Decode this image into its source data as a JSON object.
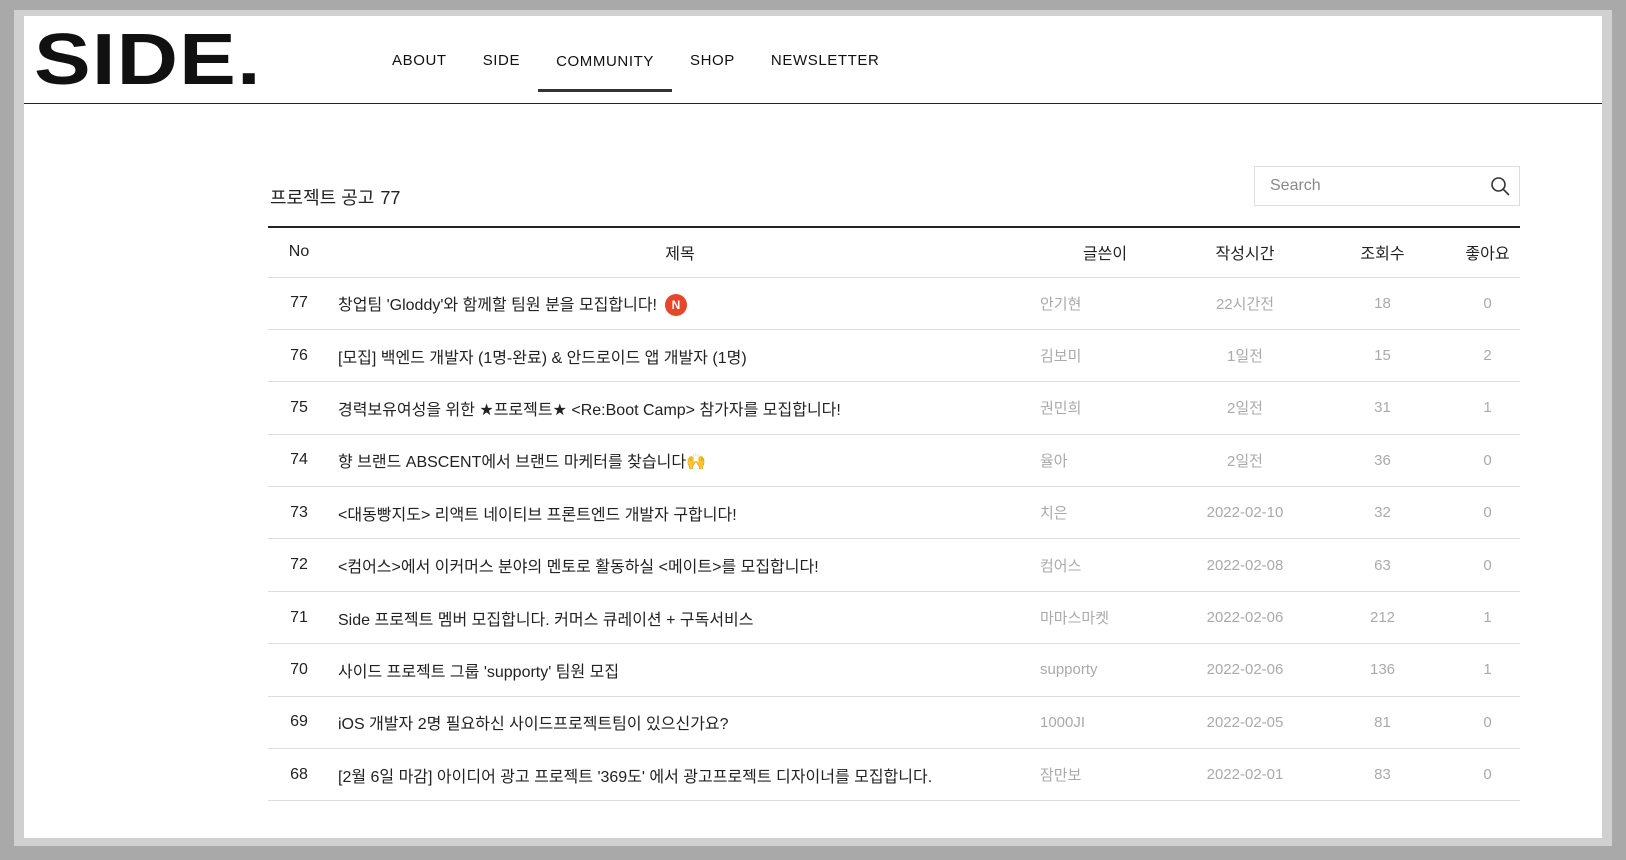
{
  "header": {
    "logo": "SIDE.",
    "nav": [
      "ABOUT",
      "SIDE",
      "COMMUNITY",
      "SHOP",
      "NEWSLETTER"
    ],
    "active_nav": "COMMUNITY"
  },
  "board": {
    "title": "프로젝트 공고",
    "count": "77",
    "search_placeholder": "Search",
    "columns": {
      "no": "No",
      "title": "제목",
      "writer": "글쓴이",
      "date": "작성시간",
      "views": "조회수",
      "likes": "좋아요"
    },
    "new_badge": "N",
    "rows": [
      {
        "no": "77",
        "title": "창업팀 'Gloddy'와 함께할 팀원 분을 모집합니다!",
        "is_new": true,
        "writer": "안기현",
        "date": "22시간전",
        "views": "18",
        "likes": "0"
      },
      {
        "no": "76",
        "title": "[모집] 백엔드 개발자 (1명-완료) & 안드로이드 앱 개발자 (1명)",
        "is_new": false,
        "writer": "김보미",
        "date": "1일전",
        "views": "15",
        "likes": "2"
      },
      {
        "no": "75",
        "title": "경력보유여성을 위한 ★프로젝트★ <Re:Boot Camp> 참가자를 모집합니다!",
        "is_new": false,
        "writer": "권민희",
        "date": "2일전",
        "views": "31",
        "likes": "1"
      },
      {
        "no": "74",
        "title": "향 브랜드 ABSCENT에서 브랜드 마케터를 찾습니다🙌",
        "is_new": false,
        "writer": "율아",
        "date": "2일전",
        "views": "36",
        "likes": "0"
      },
      {
        "no": "73",
        "title": "<대동빵지도> 리액트 네이티브 프론트엔드 개발자 구합니다!",
        "is_new": false,
        "writer": "치은",
        "date": "2022-02-10",
        "views": "32",
        "likes": "0"
      },
      {
        "no": "72",
        "title": "<컴어스>에서 이커머스 분야의 멘토로 활동하실 <메이트>를 모집합니다!",
        "is_new": false,
        "writer": "컴어스",
        "date": "2022-02-08",
        "views": "63",
        "likes": "0"
      },
      {
        "no": "71",
        "title": "Side 프로젝트 멤버 모집합니다. 커머스 큐레이션 + 구독서비스",
        "is_new": false,
        "writer": "마마스마켓",
        "date": "2022-02-06",
        "views": "212",
        "likes": "1"
      },
      {
        "no": "70",
        "title": "사이드 프로젝트 그룹 'supporty' 팀원 모집",
        "is_new": false,
        "writer": "supporty",
        "date": "2022-02-06",
        "views": "136",
        "likes": "1"
      },
      {
        "no": "69",
        "title": "iOS 개발자 2명 필요하신 사이드프로젝트팀이 있으신가요?",
        "is_new": false,
        "writer": "1000JI",
        "date": "2022-02-05",
        "views": "81",
        "likes": "0"
      },
      {
        "no": "68",
        "title": "[2월 6일 마감] 아이디어 광고 프로젝트 '369도' 에서 광고프로젝트 디자이너를 모집합니다.",
        "is_new": false,
        "writer": "잠만보",
        "date": "2022-02-01",
        "views": "83",
        "likes": "0"
      }
    ]
  }
}
